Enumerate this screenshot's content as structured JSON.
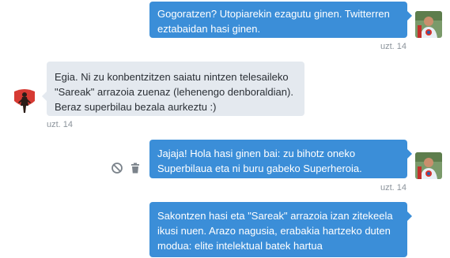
{
  "conversation": {
    "messages": [
      {
        "direction": "sent",
        "text": "Gogoratzen? Utopiarekin ezagutu ginen. Twitterren\neztabaidan hasi ginen.",
        "time": "uzt. 14"
      },
      {
        "direction": "received",
        "text": "Egia. Ni zu konbentzitzen saiatu nintzen telesaileko\n\"Sareak\" arrazoia zuenaz (lehenengo denboraldian).\nBeraz superbilau bezala aurkeztu :)",
        "time": "uzt. 14"
      },
      {
        "direction": "sent",
        "text": "Jajaja! Hola hasi ginen bai: zu bihotz oneko\nSuperbilaua eta ni buru gabeko Superheroia.",
        "time": "uzt. 14"
      },
      {
        "direction": "sent",
        "text": "Sakontzen hasi eta \"Sareak\" arrazoia izan zitekeela\nikusi nuen. Arazo nagusia, erabakia hartzeko duten\nmodua: elite intelektual batek hartua",
        "time": ""
      }
    ]
  },
  "icons": {
    "block": "block-icon",
    "delete": "trash-icon",
    "avatar_self": "avatar-self",
    "avatar_other": "avatar-other"
  },
  "colors": {
    "sent_bubble": "#3b8ed8",
    "received_bubble": "#e4e9ef",
    "timestamp": "#8b939b"
  }
}
